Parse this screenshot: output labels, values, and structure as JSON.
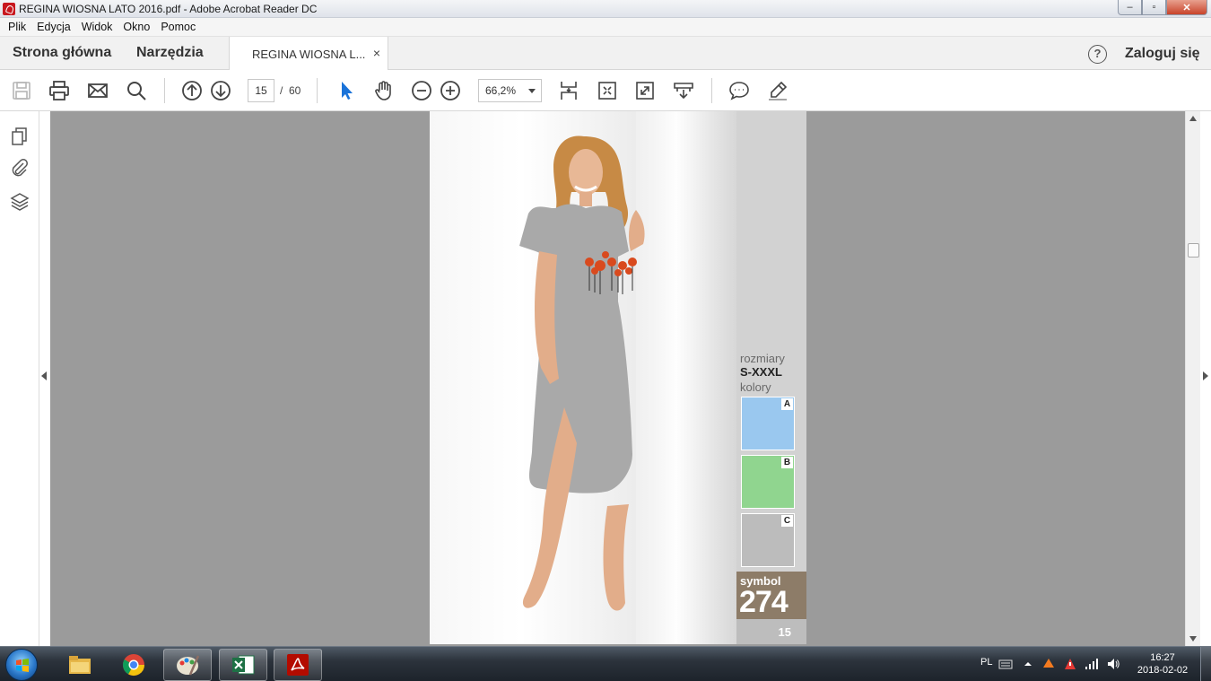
{
  "window": {
    "title": "REGINA WIOSNA LATO 2016.pdf - Adobe Acrobat Reader DC",
    "controls": {
      "minimize": "‒",
      "maximize": "▫",
      "close": "✕"
    }
  },
  "menu": [
    "Plik",
    "Edycja",
    "Widok",
    "Okno",
    "Pomoc"
  ],
  "tabs": {
    "home": "Strona główna",
    "tools": "Narzędzia",
    "document": "REGINA WIOSNA L...",
    "close": "×",
    "help": "?",
    "login": "Zaloguj się"
  },
  "toolbar": {
    "icons": [
      "save-icon",
      "print-icon",
      "email-icon",
      "search-icon",
      "previous-page-icon",
      "next-page-icon",
      "select-cursor-icon",
      "hand-tool-icon",
      "zoom-out-icon",
      "zoom-in-icon",
      "scroll-mode-icon",
      "fit-page-icon",
      "full-screen-icon",
      "read-mode-icon",
      "comment-icon",
      "highlight-icon"
    ],
    "current_page": "15",
    "page_separator": "/",
    "total_pages": "60",
    "zoom": "66,2%"
  },
  "left_pane": {
    "icons": [
      "page-thumbnails-icon",
      "attachments-icon",
      "layers-icon"
    ]
  },
  "pdf_page": {
    "sizes_label": "rozmiary",
    "sizes_value": "S-XXXL",
    "colors_label": "kolory",
    "swatches": [
      {
        "letter": "A",
        "color": "#9ac8ef"
      },
      {
        "letter": "B",
        "color": "#90d58f"
      },
      {
        "letter": "C",
        "color": "#bcbcbc"
      }
    ],
    "symbol_label": "symbol",
    "symbol_number": "274",
    "page_number": "15",
    "colors": {
      "sidebar": "#d2d2d2",
      "symbol_box": "#8d7c68",
      "dress": "#a9a9a9"
    }
  },
  "taskbar": {
    "apps": [
      "windows-explorer-icon",
      "chrome-icon",
      "paint-icon",
      "excel-icon",
      "acrobat-reader-icon"
    ],
    "language": "PL",
    "time": "16:27",
    "date": "2018-02-02"
  }
}
